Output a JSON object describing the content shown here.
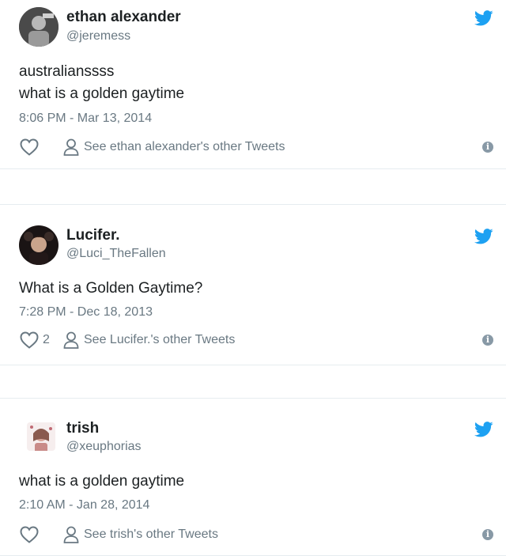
{
  "colors": {
    "twitter_blue": "#1da1f2",
    "text_primary": "#1c2022",
    "text_secondary": "#697882",
    "border": "#e6ecf0"
  },
  "tweets": [
    {
      "author_name": "ethan alexander",
      "handle": "@jeremess",
      "text_lines": [
        "australianssss",
        "what is a golden gaytime"
      ],
      "timestamp": "8:06 PM - Mar 13, 2014",
      "like_count": "",
      "other_tweets_link": "See ethan alexander's other Tweets",
      "icons": [
        "avatar",
        "twitter-bird-icon",
        "heart-icon",
        "person-icon",
        "info-icon"
      ]
    },
    {
      "author_name": "Lucifer.",
      "handle": "@Luci_TheFallen",
      "text_lines": [
        "What is a Golden Gaytime?"
      ],
      "timestamp": "7:28 PM - Dec 18, 2013",
      "like_count": "2",
      "other_tweets_link": "See Lucifer.'s other Tweets",
      "icons": [
        "avatar",
        "twitter-bird-icon",
        "heart-icon",
        "person-icon",
        "info-icon"
      ]
    },
    {
      "author_name": "trish",
      "handle": "@xeuphorias",
      "text_lines": [
        "what is a golden gaytime"
      ],
      "timestamp": "2:10 AM - Jan 28, 2014",
      "like_count": "",
      "other_tweets_link": "See trish's other Tweets",
      "icons": [
        "avatar",
        "twitter-bird-icon",
        "heart-icon",
        "person-icon",
        "info-icon"
      ]
    }
  ]
}
